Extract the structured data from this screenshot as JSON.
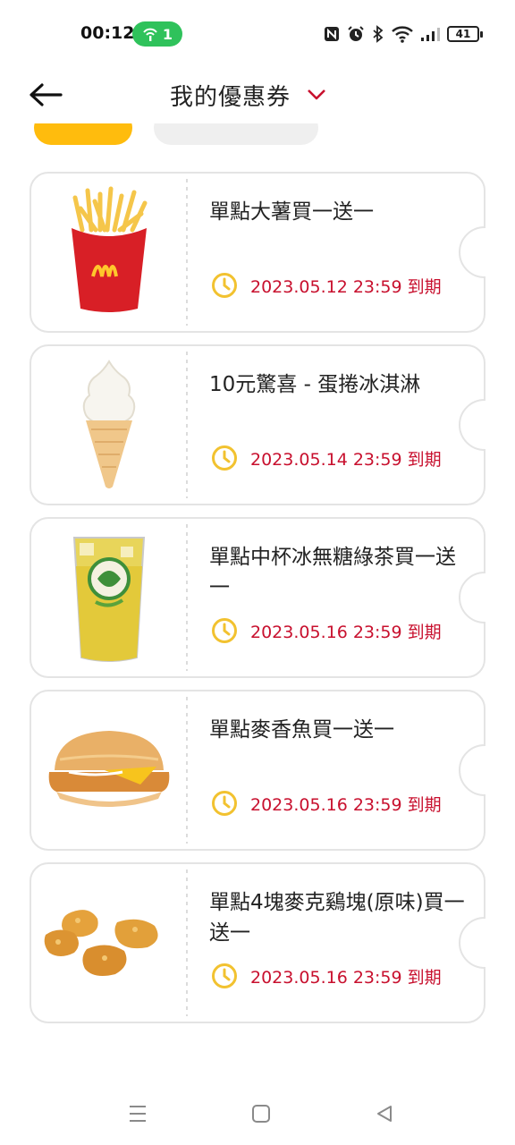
{
  "status_bar": {
    "time": "00:12",
    "hotspot_count": "1",
    "battery": "41",
    "icons": [
      "hotspot-icon",
      "nfc-icon",
      "alarm-icon",
      "bluetooth-icon",
      "wifi-icon",
      "signal-icon",
      "battery-icon"
    ]
  },
  "header": {
    "back_icon": "arrow-left-icon",
    "title": "我的優惠券",
    "dropdown_icon": "chevron-down-icon"
  },
  "colors": {
    "accent_red": "#c8102e",
    "mcd_yellow": "#ffbc0d",
    "clock_yellow": "#f2c230",
    "hotspot_green": "#2fc25b"
  },
  "coupons": [
    {
      "name": "單點大薯買一送一",
      "expiry": "2023.05.12 23:59 到期",
      "image": "fries-image"
    },
    {
      "name": "10元驚喜 - 蛋捲冰淇淋",
      "expiry": "2023.05.14 23:59 到期",
      "image": "ice-cream-cone-image"
    },
    {
      "name": "單點中杯冰無糖綠茶買一送一",
      "expiry": "2023.05.16 23:59 到期",
      "image": "green-tea-image"
    },
    {
      "name": "單點麥香魚買一送一",
      "expiry": "2023.05.16 23:59 到期",
      "image": "filet-o-fish-image"
    },
    {
      "name": "單點4塊麥克鷄塊(原味)買一送一",
      "expiry": "2023.05.16 23:59 到期",
      "image": "chicken-nuggets-image"
    }
  ],
  "nav_bar": [
    "menu-icon",
    "home-square-icon",
    "back-triangle-icon"
  ]
}
